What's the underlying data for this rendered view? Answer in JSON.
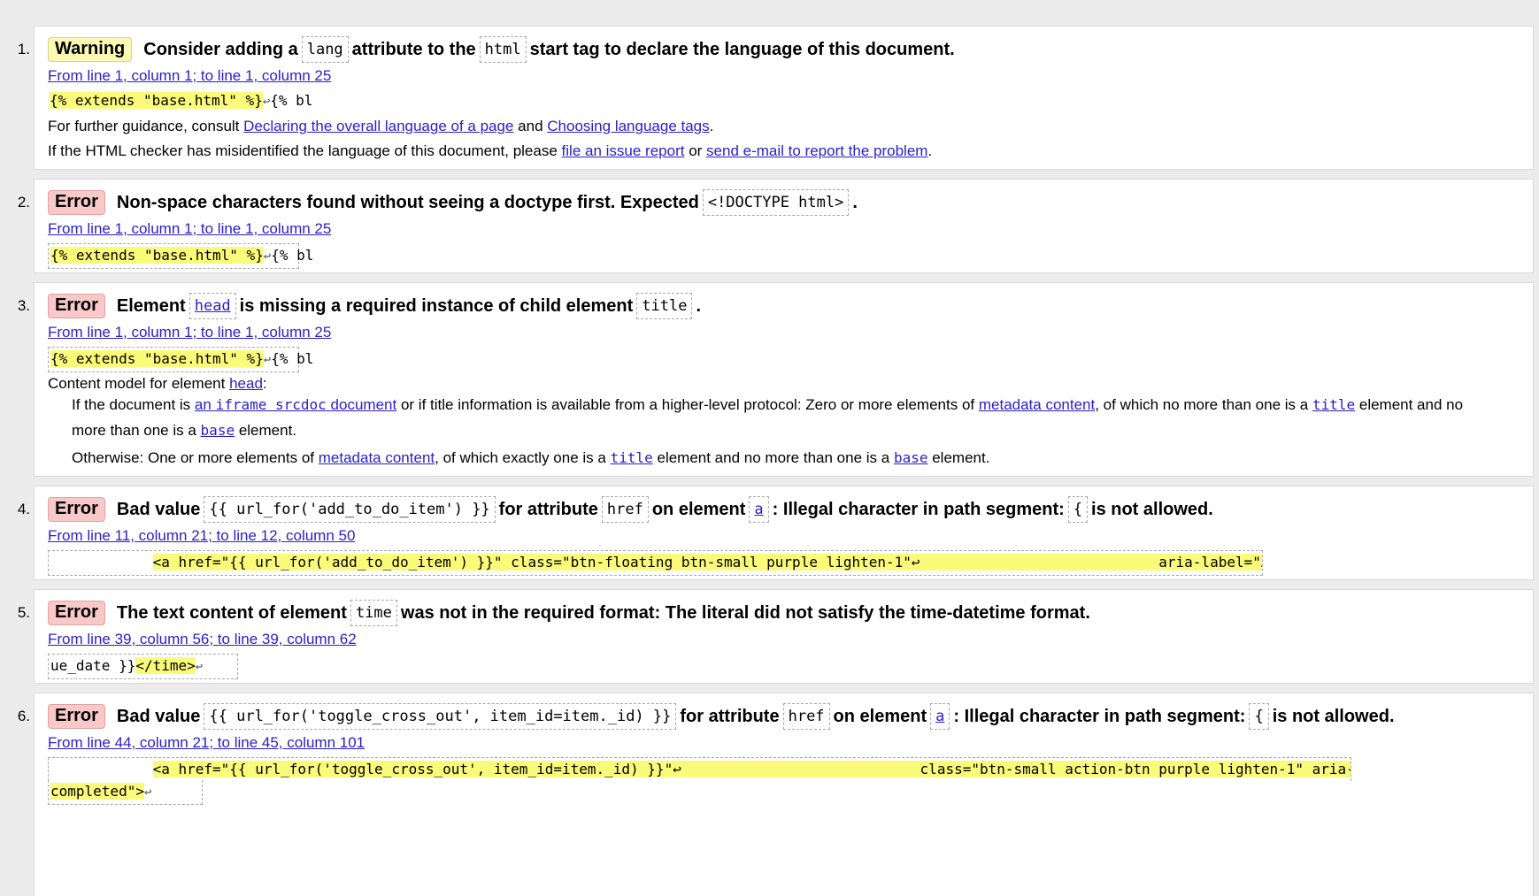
{
  "messages": [
    {
      "num": "1.",
      "type_label": "Warning",
      "parts": [
        "Consider adding a",
        "lang",
        "attribute to the",
        "html",
        "start tag to declare the language of this document."
      ],
      "location": "From line 1, column 1; to line 1, column 25",
      "extract_hl": "{% extends \"base.html\" %}",
      "extract_rest": "{% bl",
      "guidance_pre": "For further guidance, consult",
      "guidance_link1": "Declaring the overall language of a page",
      "guidance_and": "and",
      "guidance_link2": "Choosing language tags",
      "guidance_end": ".",
      "issue_pre": "If the HTML checker has misidentified the language of this document, please",
      "issue_link1": "file an issue report",
      "issue_or": "or",
      "issue_link2": "send e-mail to report the problem",
      "issue_end": "."
    },
    {
      "num": "2.",
      "type_label": "Error",
      "parts": [
        "Non-space characters found without seeing a doctype first. Expected",
        "<!DOCTYPE html>",
        "."
      ],
      "location": "From line 1, column 1; to line 1, column 25",
      "extract_hl": "{% extends \"base.html\" %}",
      "extract_rest": "{% bl"
    },
    {
      "num": "3.",
      "type_label": "Error",
      "parts": [
        "Element",
        "head",
        "is missing a required instance of child element",
        "title",
        "."
      ],
      "location": "From line 1, column 1; to line 1, column 25",
      "extract_hl": "{% extends \"base.html\" %}",
      "extract_rest": "{% bl",
      "cm_pre": "Content model for element",
      "cm_link": "head",
      "cm_end": ":",
      "if_pre": "If the document is",
      "if_link1_a": "an",
      "if_link1_code": "iframe srcdoc",
      "if_link1_b": "document",
      "if_mid": "or if title information is available from a higher-level protocol: Zero or more elements of",
      "if_link2": "metadata content",
      "if_mid2": ", of which no more than one is a",
      "if_link3": "title",
      "if_end": "element and no",
      "if2_pre": "more than one is a",
      "if2_link": "base",
      "if2_end": "element.",
      "ow_pre": "Otherwise: One or more elements of",
      "ow_link1": "metadata content",
      "ow_mid": ", of which exactly one is a",
      "ow_link2": "title",
      "ow_mid2": "element and no more than one is a",
      "ow_link3": "base",
      "ow_end": "element."
    },
    {
      "num": "4.",
      "type_label": "Error",
      "parts": [
        "Bad value",
        "{{ url_for('add_to_do_item') }}",
        "for attribute",
        "href",
        "on element",
        "a",
        ": Illegal character in path segment:",
        "{",
        "is not allowed."
      ],
      "location": "From line 11, column 21; to line 12, column 50",
      "extract_pre": "            ",
      "extract_hl": "<a href=\"{{ url_for('add_to_do_item') }}\" class=\"btn-floating btn-small purple lighten-1\"↩                            aria-label=\"Add new item\">",
      "extract_rest": ""
    },
    {
      "num": "5.",
      "type_label": "Error",
      "parts": [
        "The text content of element",
        "time",
        "was not in the required format: The literal did not satisfy the time-datetime format."
      ],
      "location": "From line 39, column 56; to line 39, column 62",
      "extract_pre": "ue_date }}",
      "extract_hl": "</time>",
      "extract_rest": ""
    },
    {
      "num": "6.",
      "type_label": "Error",
      "parts": [
        "Bad value",
        "{{ url_for('toggle_cross_out', item_id=item._id) }}",
        "for attribute",
        "href",
        "on element",
        "a",
        ": Illegal character in path segment:",
        "{",
        "is not allowed."
      ],
      "location": "From line 44, column 21; to line 45, column 101",
      "extract_pre": "            ",
      "extract_hl": "<a href=\"{{ url_for('toggle_cross_out', item_id=item._id) }}\"↩                            class=\"btn-small action-btn purple lighten-1\" aria-label=\"Mark as",
      "extract_hl2": "completed\">"
    }
  ],
  "return_glyph": "↩"
}
